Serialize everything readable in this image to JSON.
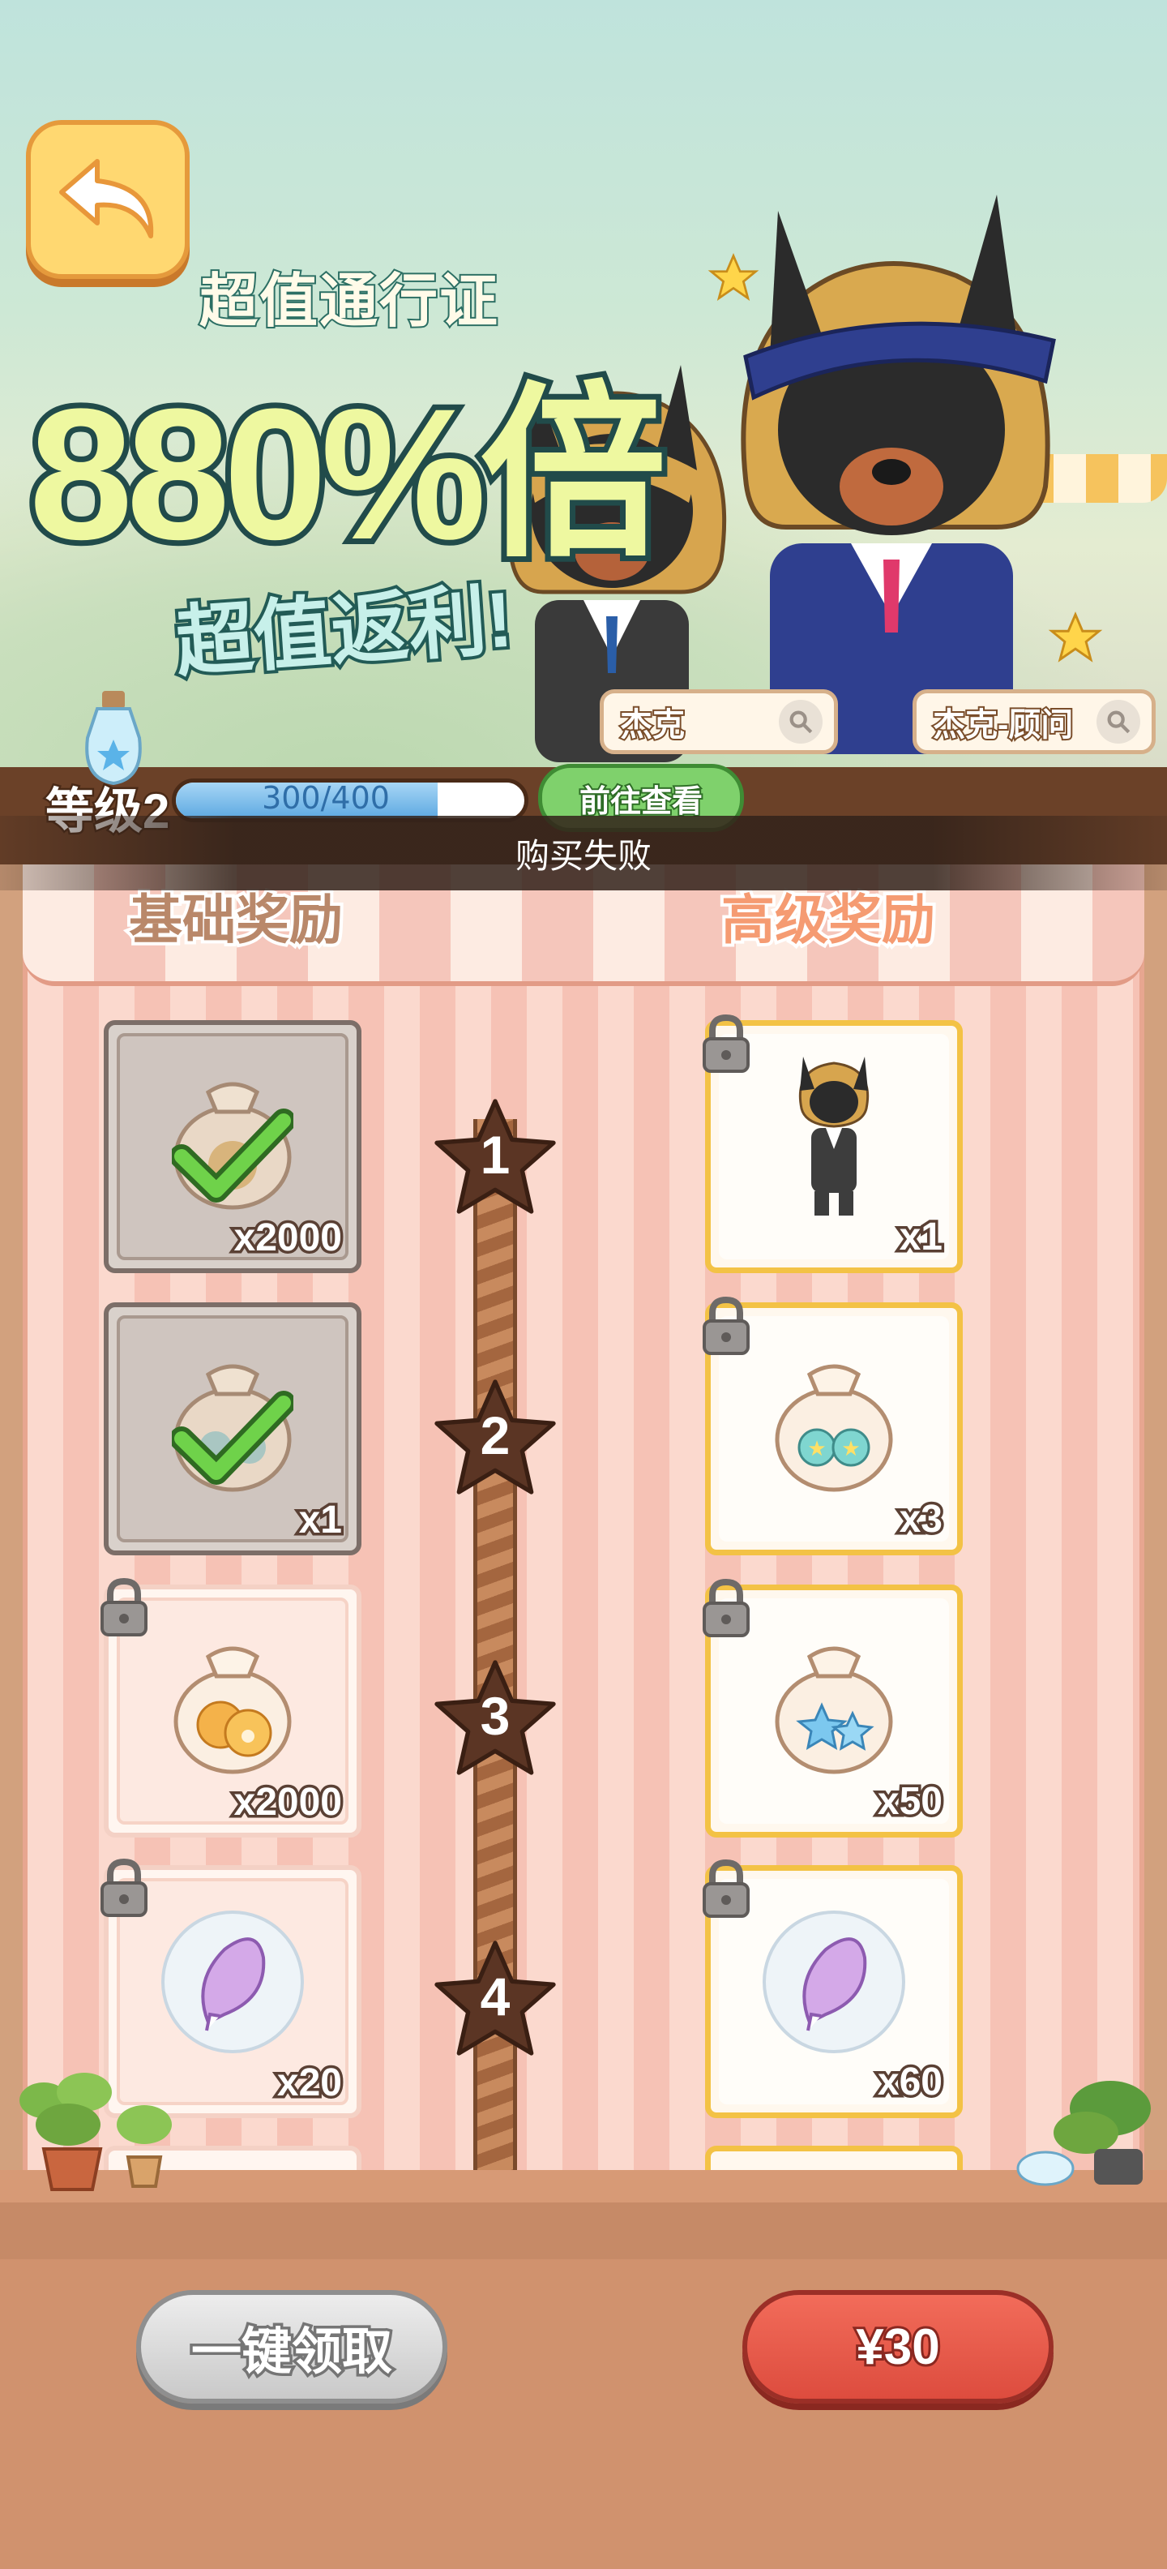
{
  "banner": {
    "pass_title": "超值通行证",
    "percent_text": "880%倍",
    "rebate_text": "超值返利!",
    "character_tags": [
      {
        "name": "杰克",
        "icon": "magnifier-icon"
      },
      {
        "name": "杰克-顾问",
        "icon": "magnifier-icon"
      }
    ]
  },
  "level": {
    "label": "等级2",
    "progress_text": "300/400",
    "progress_fraction": 0.75,
    "goto_label": "前往查看"
  },
  "toast": {
    "message": "购买失败"
  },
  "tabs": {
    "basic": "基础奖励",
    "advanced": "高级奖励"
  },
  "rewards": [
    {
      "level": "1",
      "basic": {
        "qty": "x2000",
        "icon": "paw-cookie-bag-icon",
        "claimed": true,
        "locked": false
      },
      "advanced": {
        "qty": "x1",
        "icon": "jack-costume-icon",
        "locked": true
      }
    },
    {
      "level": "2",
      "basic": {
        "qty": "x1",
        "icon": "star-ticket-bag-icon",
        "claimed": true,
        "locked": false
      },
      "advanced": {
        "qty": "x3",
        "icon": "star-ticket-bag-icon",
        "locked": true
      }
    },
    {
      "level": "3",
      "basic": {
        "qty": "x2000",
        "icon": "paw-cookie-bag-icon",
        "claimed": false,
        "locked": true
      },
      "advanced": {
        "qty": "x50",
        "icon": "blue-star-bag-icon",
        "locked": true
      }
    },
    {
      "level": "4",
      "basic": {
        "qty": "x20",
        "icon": "purple-leaf-icon",
        "claimed": false,
        "locked": true
      },
      "advanced": {
        "qty": "x60",
        "icon": "purple-leaf-icon",
        "locked": true
      }
    }
  ],
  "footer": {
    "claim_all_label": "一键领取",
    "buy_label": "¥30"
  },
  "colors": {
    "buy_button": "#dd4c3e",
    "claim_button": "#c9c9c9",
    "goto_button": "#7fd16c",
    "accent_gold": "#f3c245"
  }
}
